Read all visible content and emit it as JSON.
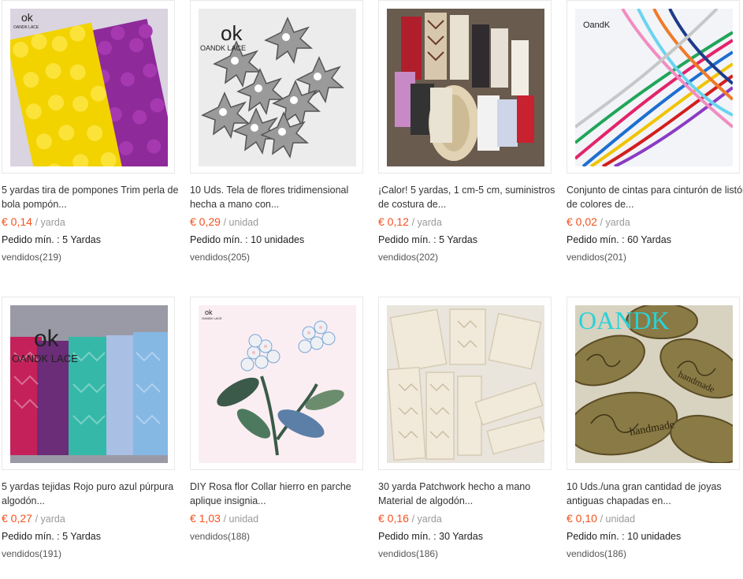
{
  "products": [
    {
      "title": "5 yardas tira de pompones Trim perla de bola pompón...",
      "price": "€ 0,14",
      "unit": "/ yarda",
      "min_order": "Pedido mín. : 5 Yardas",
      "sold": "vendidos(219)",
      "image_label": "OANDK LACE"
    },
    {
      "title": "10 Uds. Tela de flores tridimensional hecha a mano con...",
      "price": "€ 0,29",
      "unit": "/ unidad",
      "min_order": "Pedido mín. : 10 unidades",
      "sold": "vendidos(205)",
      "image_label": "OANDK LACE"
    },
    {
      "title": "¡Calor! 5 yardas, 1 cm-5 cm, suministros de costura de...",
      "price": "€ 0,12",
      "unit": "/ yarda",
      "min_order": "Pedido mín. : 5 Yardas",
      "sold": "vendidos(202)",
      "image_label": ""
    },
    {
      "title": "Conjunto de cintas para cinturón de listón de colores de...",
      "price": "€ 0,02",
      "unit": "/ yarda",
      "min_order": "Pedido mín. : 60 Yardas",
      "sold": "vendidos(201)",
      "image_label": "OandK"
    },
    {
      "title": "5 yardas tejidas Rojo puro azul púrpura algodón...",
      "price": "€ 0,27",
      "unit": "/ yarda",
      "min_order": "Pedido mín. : 5 Yardas",
      "sold": "vendidos(191)",
      "image_label": "OANDK LACE"
    },
    {
      "title": "DIY Rosa flor Collar hierro en parche aplique insignia...",
      "price": "€ 1,03",
      "unit": "/ unidad",
      "min_order": "",
      "sold": "vendidos(188)",
      "image_label": "OANDK LACE"
    },
    {
      "title": "30 yarda Patchwork hecho a mano Material de algodón...",
      "price": "€ 0,16",
      "unit": "/ yarda",
      "min_order": "Pedido mín. : 30 Yardas",
      "sold": "vendidos(186)",
      "image_label": ""
    },
    {
      "title": "10 Uds./una gran cantidad de joyas antiguas chapadas en...",
      "price": "€ 0,10",
      "unit": "/ unidad",
      "min_order": "Pedido mín. : 10 unidades",
      "sold": "vendidos(186)",
      "image_label": "OANDK",
      "stamp_text": "handmade"
    }
  ],
  "colors": {
    "price": "#f4511e",
    "unit": "#999999",
    "border": "#e8e8e8"
  }
}
